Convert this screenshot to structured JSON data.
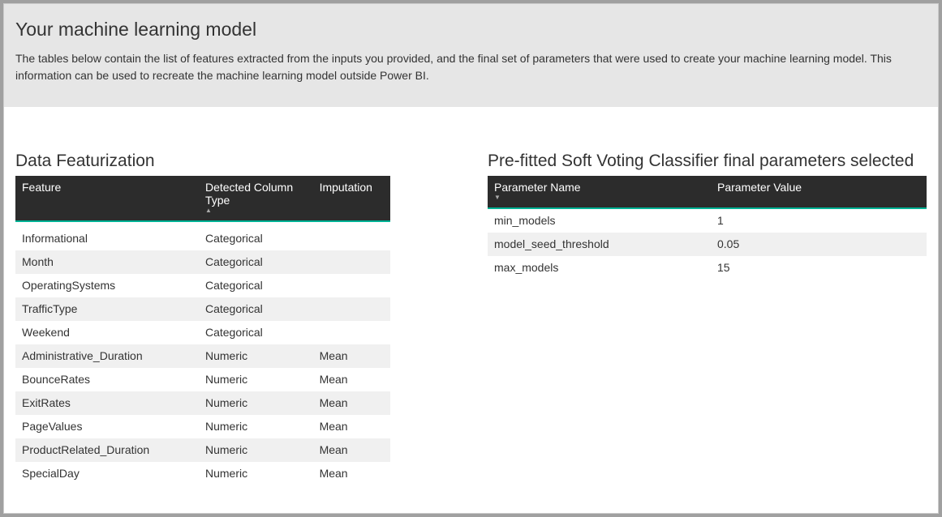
{
  "header": {
    "title": "Your machine learning model",
    "description": "The tables below contain the list of features extracted from the inputs you provided, and the final set of parameters that were used to create your machine learning model.  This information can be used to recreate the machine learning model outside Power BI."
  },
  "featurization": {
    "title": "Data Featurization",
    "columns": {
      "feature": "Feature",
      "detected": "Detected Column Type",
      "imputation": "Imputation"
    },
    "rows": [
      {
        "feature": "Informational",
        "detected": "Categorical",
        "imputation": ""
      },
      {
        "feature": "Month",
        "detected": "Categorical",
        "imputation": ""
      },
      {
        "feature": "OperatingSystems",
        "detected": "Categorical",
        "imputation": ""
      },
      {
        "feature": "TrafficType",
        "detected": "Categorical",
        "imputation": ""
      },
      {
        "feature": "Weekend",
        "detected": "Categorical",
        "imputation": ""
      },
      {
        "feature": "Administrative_Duration",
        "detected": "Numeric",
        "imputation": "Mean"
      },
      {
        "feature": "BounceRates",
        "detected": "Numeric",
        "imputation": "Mean"
      },
      {
        "feature": "ExitRates",
        "detected": "Numeric",
        "imputation": "Mean"
      },
      {
        "feature": "PageValues",
        "detected": "Numeric",
        "imputation": "Mean"
      },
      {
        "feature": "ProductRelated_Duration",
        "detected": "Numeric",
        "imputation": "Mean"
      },
      {
        "feature": "SpecialDay",
        "detected": "Numeric",
        "imputation": "Mean"
      }
    ]
  },
  "parameters": {
    "title": "Pre-fitted Soft Voting Classifier final parameters selected",
    "columns": {
      "name": "Parameter Name",
      "value": "Parameter Value"
    },
    "rows": [
      {
        "name": "min_models",
        "value": "1"
      },
      {
        "name": "model_seed_threshold",
        "value": "0.05"
      },
      {
        "name": "max_models",
        "value": "15"
      }
    ]
  }
}
